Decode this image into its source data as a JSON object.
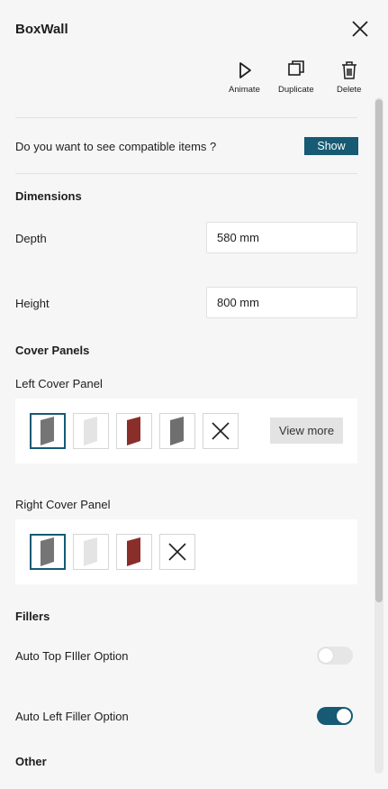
{
  "header": {
    "title": "BoxWall",
    "actions": [
      {
        "label": "Animate",
        "icon": "play-icon"
      },
      {
        "label": "Duplicate",
        "icon": "duplicate-icon"
      },
      {
        "label": "Delete",
        "icon": "trash-icon"
      }
    ]
  },
  "compatible": {
    "question": "Do you want to see compatible items ?",
    "button_label": "Show"
  },
  "dimensions": {
    "heading": "Dimensions",
    "depth_label": "Depth",
    "depth_value": "580 mm",
    "height_label": "Height",
    "height_value": "800 mm"
  },
  "cover_panels": {
    "heading": "Cover Panels",
    "left_label": "Left Cover Panel",
    "right_label": "Right Cover Panel",
    "view_more_label": "View more",
    "left_swatches": [
      {
        "name": "dark-grey",
        "color": "#757575",
        "selected": true
      },
      {
        "name": "light-grey",
        "color": "#e4e4e4",
        "selected": false
      },
      {
        "name": "red",
        "color": "#8a2e2a",
        "selected": false
      },
      {
        "name": "medium-grey",
        "color": "#6f6f6f",
        "selected": false
      },
      {
        "name": "none",
        "color": "",
        "selected": false
      }
    ],
    "right_swatches": [
      {
        "name": "dark-grey",
        "color": "#757575",
        "selected": true
      },
      {
        "name": "light-grey",
        "color": "#e4e4e4",
        "selected": false
      },
      {
        "name": "red",
        "color": "#8a2e2a",
        "selected": false
      },
      {
        "name": "none",
        "color": "",
        "selected": false
      }
    ]
  },
  "fillers": {
    "heading": "Fillers",
    "auto_top_label": "Auto Top FIller Option",
    "auto_top_on": false,
    "auto_left_label": "Auto Left Filler Option",
    "auto_left_on": true
  },
  "other": {
    "heading": "Other"
  },
  "colors": {
    "accent": "#165a73",
    "background": "#f6f6f6"
  }
}
